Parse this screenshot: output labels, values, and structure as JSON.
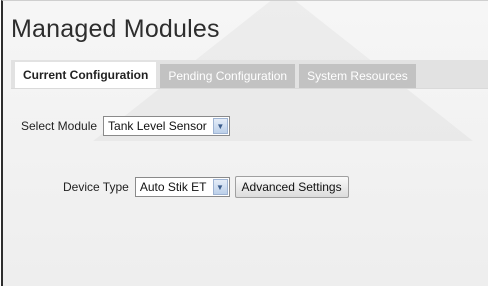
{
  "title": "Managed Modules",
  "tabs": [
    {
      "label": "Current Configuration",
      "active": true
    },
    {
      "label": "Pending Configuration",
      "active": false
    },
    {
      "label": "System Resources",
      "active": false
    }
  ],
  "select_module": {
    "label": "Select Module",
    "value": "Tank Level Sensor"
  },
  "device_type": {
    "label": "Device Type",
    "value": "Auto Stik ET"
  },
  "advanced_settings_label": "Advanced Settings",
  "icons": {
    "dropdown": "chevron-down-icon"
  },
  "colors": {
    "active_tab_bg": "#ffffff",
    "inactive_tab_bg": "#c2c2c2",
    "tabbar_bg": "#e2e2e2"
  }
}
